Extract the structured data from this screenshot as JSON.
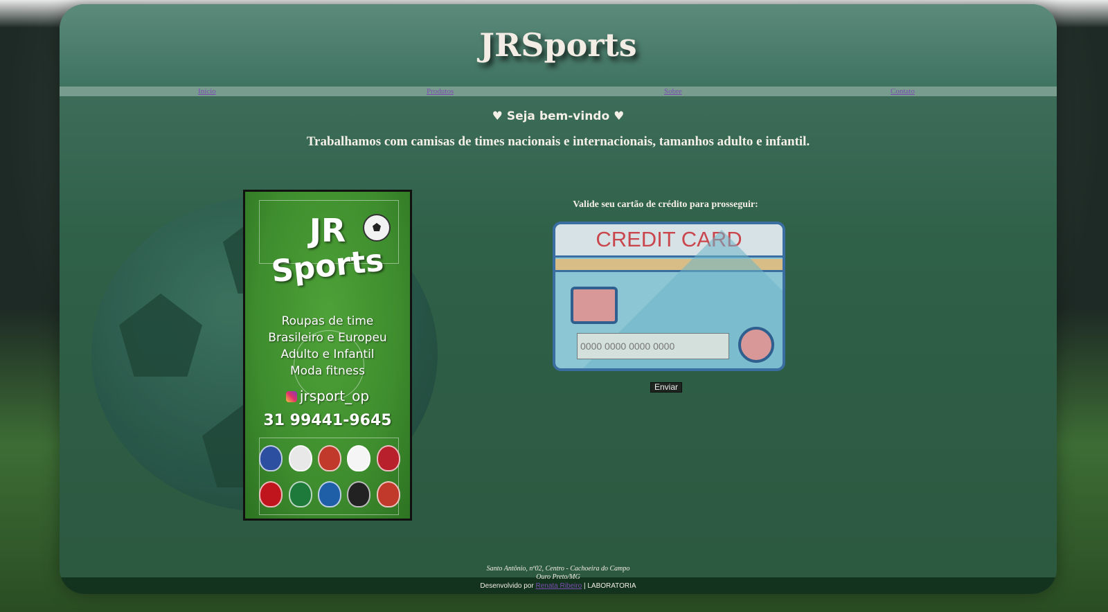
{
  "site": {
    "title": "JRSports"
  },
  "nav": [
    {
      "label": "Início"
    },
    {
      "label": "Produtos"
    },
    {
      "label": "Sobre"
    },
    {
      "label": "Contato"
    }
  ],
  "welcome": "♥ Seja bem-vindo ♥",
  "tagline": "Trabalhamos com camisas de times nacionais e internacionais, tamanhos adulto e infantil.",
  "flyer": {
    "brand_line1": "JR",
    "brand_line2": "Sports",
    "lines": [
      "Roupas  de time",
      "Brasileiro e Europeu",
      "Adulto e Infantil",
      "Moda fitness"
    ],
    "instagram": "jrsport_op",
    "phone": "31  99441-9645",
    "crest_colors": [
      "#2c4fa0",
      "#e8e8e8",
      "#c0392b",
      "#f5f5f5",
      "#b8202c",
      "#c0151d",
      "#1e7a3a",
      "#1f5fa8",
      "#222222",
      "#c0392b"
    ]
  },
  "form": {
    "label": "Valide seu cartão de crédito para prosseguir:",
    "card_title": "CREDIT CARD",
    "card_placeholder": "0000 0000 0000 0000",
    "submit_label": "Enviar"
  },
  "footer": {
    "address_line1": "Santo Antônio, nº02, Centro - Cachoeira do Campo",
    "address_line2": "Ouro Preto/MG",
    "developed_by": "Desenvolvido por",
    "developer_link": "Renata Ribeiro",
    "separator": " | ",
    "org": "LABORATORIA"
  },
  "colors": {
    "panel_green": "#2f6048",
    "title_cream": "#f3ece4",
    "card_red": "#c9464c",
    "card_blue": "#8cc6d4"
  }
}
